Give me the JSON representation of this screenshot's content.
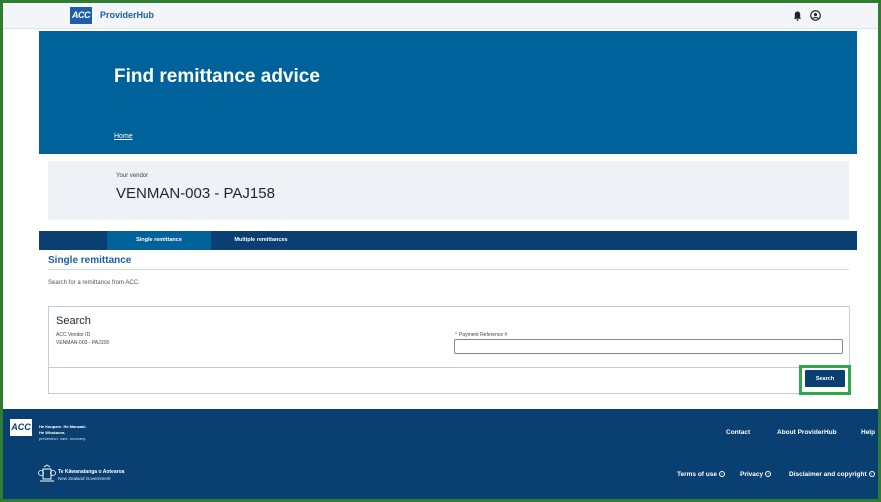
{
  "header": {
    "logo_text": "ACC",
    "brand": "ProviderHub",
    "bell_icon": "bell-icon",
    "user_icon": "user-circle-icon"
  },
  "hero": {
    "title": "Find remittance advice",
    "breadcrumb_home": "Home"
  },
  "vendor": {
    "label": "Your vendor",
    "value": "VENMAN-003 - PAJ158"
  },
  "tabs": [
    {
      "label": "Single remittance",
      "active": true
    },
    {
      "label": "Multiple remittances",
      "active": false
    }
  ],
  "section": {
    "title": "Single remittance",
    "description": "Search for a remittance from ACC."
  },
  "search": {
    "title": "Search",
    "vendor_id_label": "ACC Vendor ID",
    "vendor_id_value": "VENMAN-003 - PAJ158",
    "ref_required": "*",
    "ref_label": "Payment Reference #",
    "ref_value": "",
    "button_label": "Search"
  },
  "footer": {
    "logo_text": "ACC",
    "tagline_1": "He Kaupare. He Manaaki.",
    "tagline_2": "He Whakaora.",
    "tagline_3": "prevention. care. recovery.",
    "govt_1": "Te Kāwanatanga o Aotearoa",
    "govt_2": "New Zealand Government",
    "links_top": [
      "Contact",
      "About ProviderHub",
      "Help"
    ],
    "links_bottom": [
      "Terms of use",
      "Privacy",
      "Disclaimer and copyright"
    ]
  },
  "colors": {
    "brand_blue": "#00629b",
    "navy": "#0a3f72",
    "highlight_green": "#2fa84a"
  }
}
